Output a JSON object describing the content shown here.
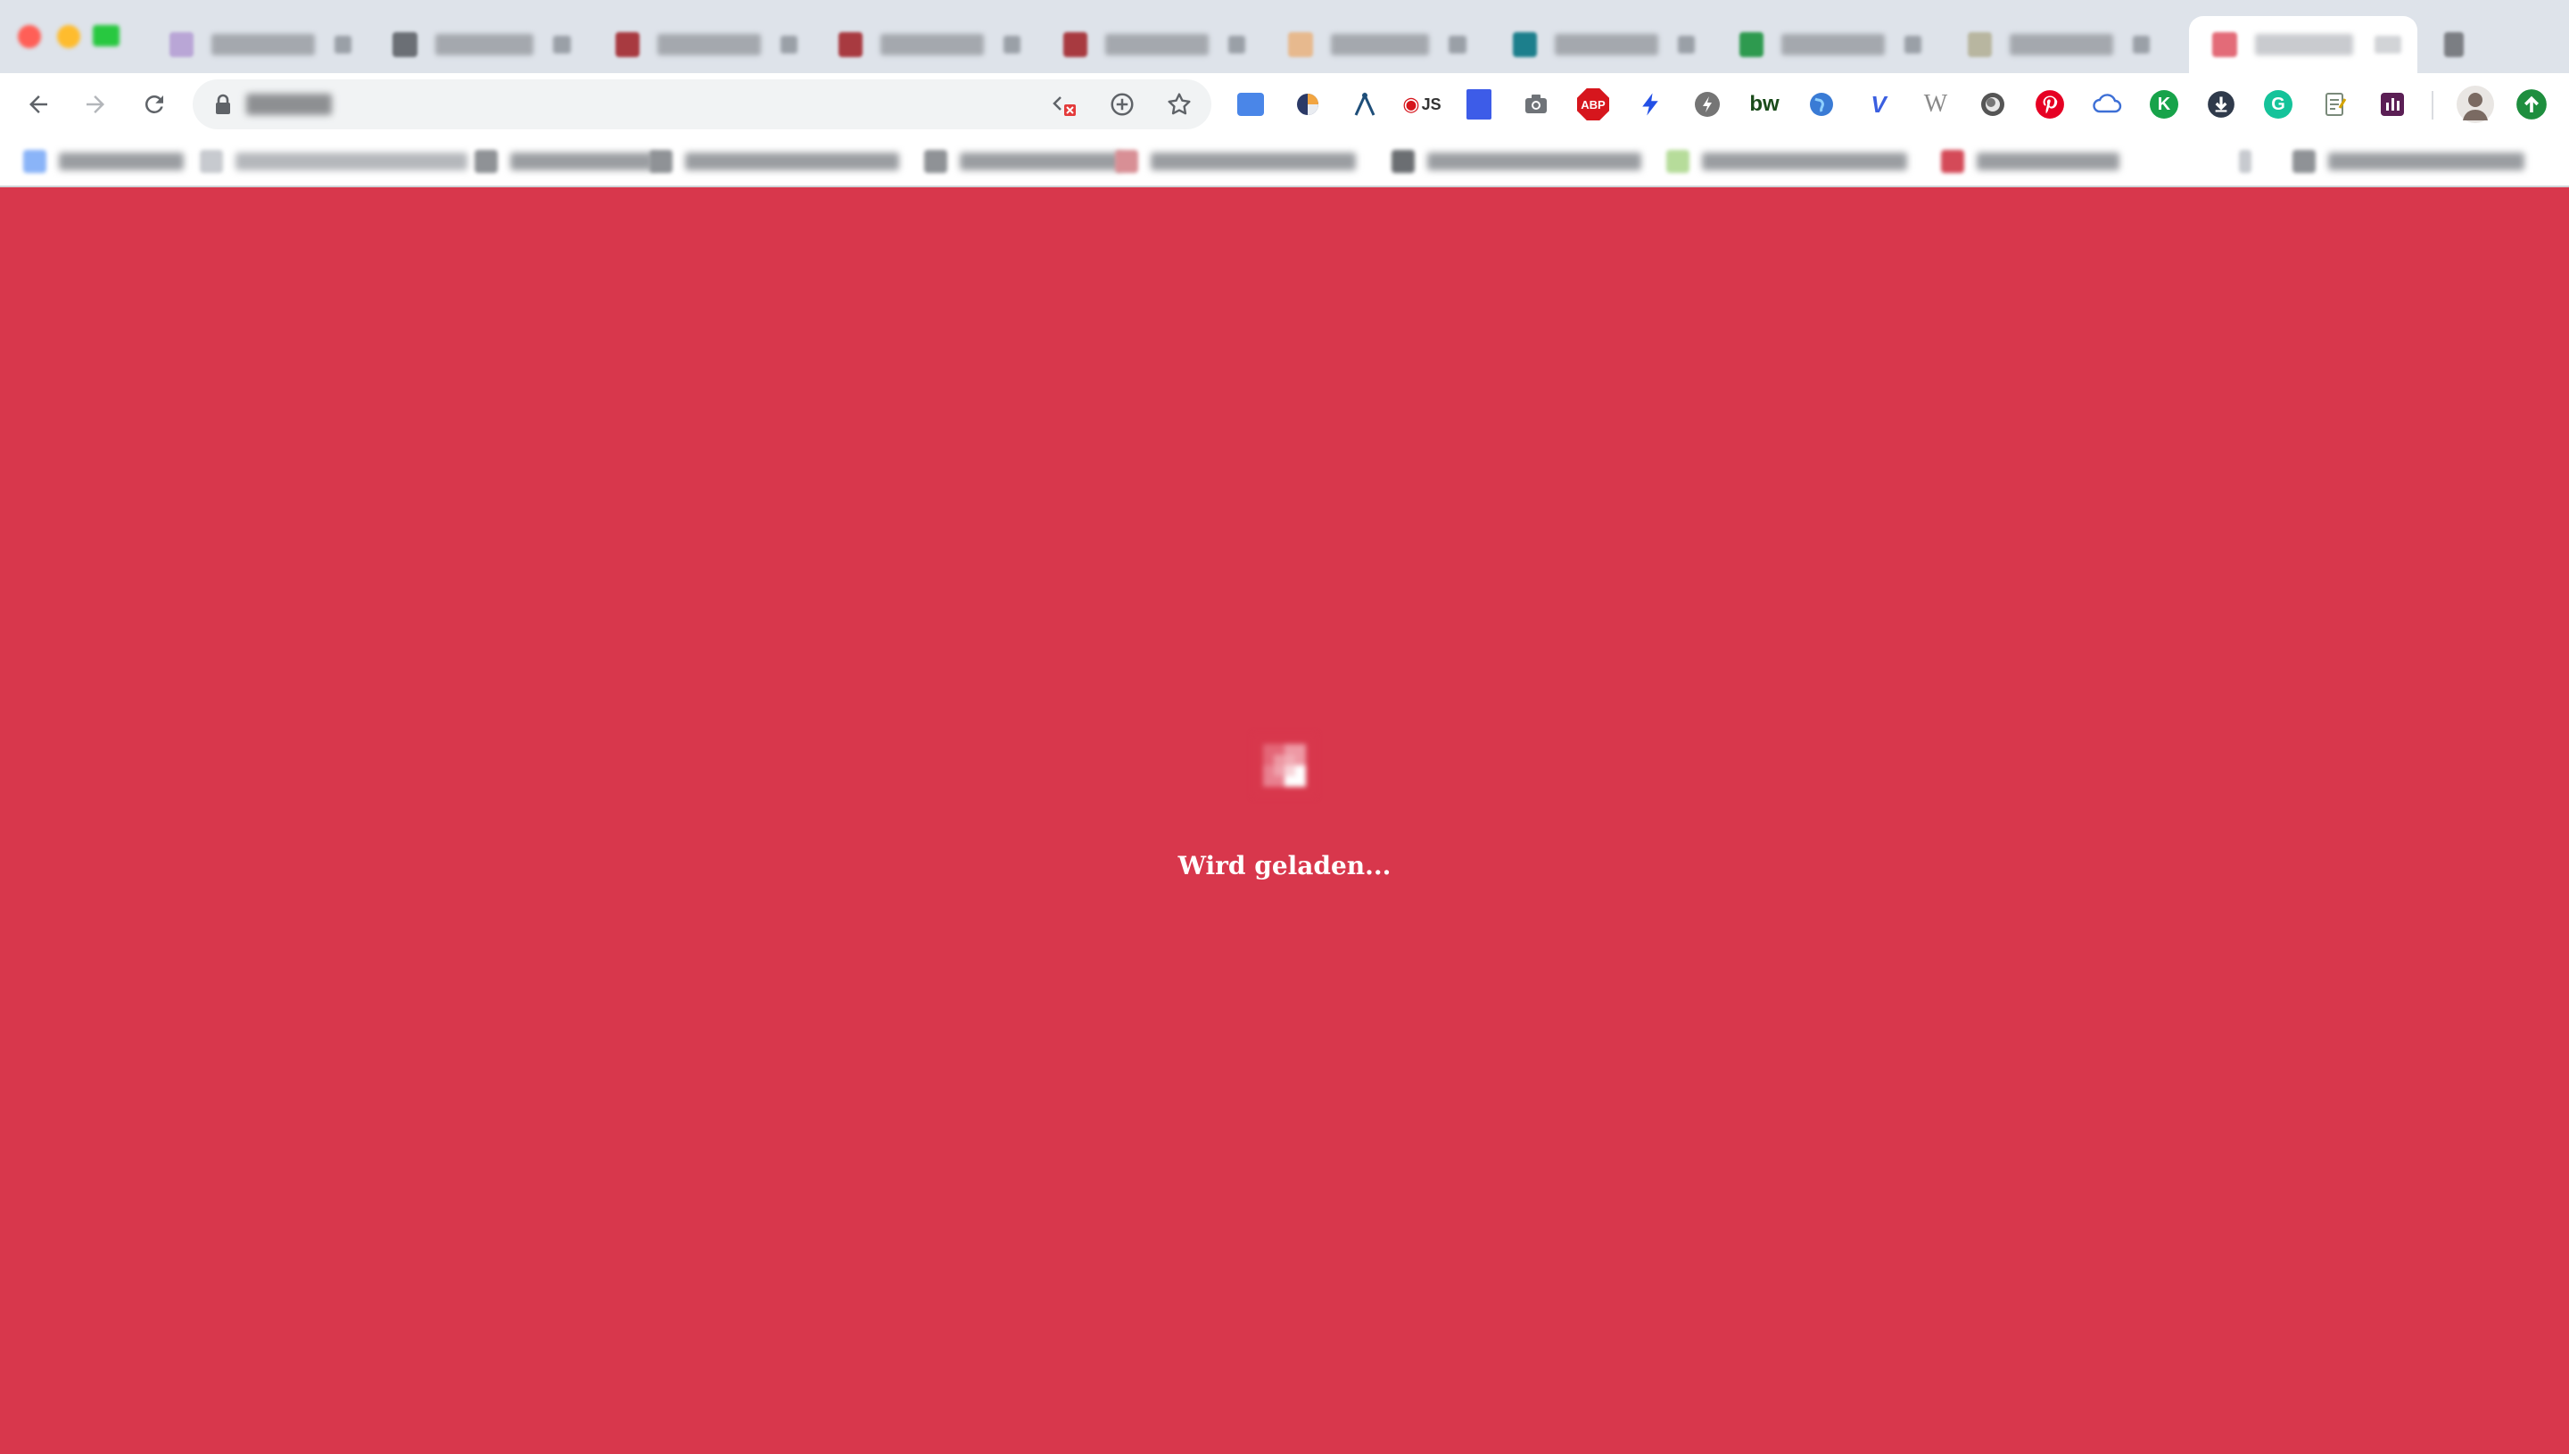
{
  "window": {
    "traffic_lights": [
      {
        "name": "close",
        "color": "#ff5f57"
      },
      {
        "name": "minimize",
        "color": "#febc2e"
      },
      {
        "name": "maximize",
        "color": "#28c840"
      }
    ]
  },
  "tabs": [
    {
      "title": "",
      "favicon_color": "#b9a6d6"
    },
    {
      "title": "",
      "favicon_color": "#6b6f75"
    },
    {
      "title": "",
      "favicon_color": "#a83a40"
    },
    {
      "title": "",
      "favicon_color": "#a83a40"
    },
    {
      "title": "",
      "favicon_color": "#a83a40"
    },
    {
      "title": "",
      "favicon_color": "#e7b98e"
    },
    {
      "title": "",
      "favicon_color": "#1c7f8c"
    },
    {
      "title": "",
      "favicon_color": "#2e9a4f"
    },
    {
      "title": "",
      "favicon_color": "#b8b6a0"
    },
    {
      "title": "",
      "favicon_color": "#e36b78",
      "active": true
    },
    {
      "title": "",
      "favicon_color": "#7b7e83"
    }
  ],
  "toolbar": {
    "url": "",
    "icons": [
      "back-icon",
      "forward-icon",
      "reload-icon",
      "lock-icon",
      "code-blocked-icon",
      "zoom-icon",
      "bookmark-star-icon"
    ]
  },
  "extensions": [
    {
      "name": "ext-translate",
      "label": "",
      "color": "#4a86e8"
    },
    {
      "name": "ext-colorpie",
      "label": "",
      "color": "#2b3a67"
    },
    {
      "name": "ext-vector",
      "label": "",
      "color": "#1e4e79"
    },
    {
      "name": "ext-js",
      "label": "JS",
      "color": "#555555"
    },
    {
      "name": "ext-ruler",
      "label": "",
      "color": "#3d5ce8"
    },
    {
      "name": "ext-camera",
      "label": "",
      "color": "#6f7378"
    },
    {
      "name": "ext-abp",
      "label": "ABP",
      "color": "#d6161d"
    },
    {
      "name": "ext-bolt",
      "label": "",
      "color": "#2350e6"
    },
    {
      "name": "ext-speed",
      "label": "",
      "color": "#757575"
    },
    {
      "name": "ext-bw",
      "label": "bw",
      "color": "#1a4b1a"
    },
    {
      "name": "ext-globe",
      "label": "",
      "color": "#3a7bd5"
    },
    {
      "name": "ext-v",
      "label": "V",
      "color": "#3b5fe0"
    },
    {
      "name": "ext-w",
      "label": "W",
      "color": "#8a8a8a"
    },
    {
      "name": "ext-circle",
      "label": "",
      "color": "#555555"
    },
    {
      "name": "ext-pinterest",
      "label": "",
      "color": "#e60023"
    },
    {
      "name": "ext-cloud",
      "label": "",
      "color": "#3d6fd6"
    },
    {
      "name": "ext-k",
      "label": "K",
      "color": "#17a34a"
    },
    {
      "name": "ext-download",
      "label": "",
      "color": "#2f3a4b"
    },
    {
      "name": "ext-grammarly",
      "label": "G",
      "color": "#15c39a"
    },
    {
      "name": "ext-note",
      "label": "",
      "color": "#7a8a7a"
    },
    {
      "name": "ext-chart",
      "label": "",
      "color": "#5b1f55"
    }
  ],
  "profile": {
    "avatar_color": "#7a6a62",
    "update_color": "#1e8e3e"
  },
  "bookmarks": [
    {
      "label": "",
      "favicon_color": "#8ab4f8"
    },
    {
      "label": "",
      "favicon_color": "#c7cacf"
    },
    {
      "label": "",
      "favicon_color": "#8f9296"
    },
    {
      "label": "",
      "favicon_color": "#8f9296"
    },
    {
      "label": "",
      "favicon_color": "#8f9296"
    },
    {
      "label": "",
      "favicon_color": "#d88f95"
    },
    {
      "label": "",
      "favicon_color": "#6b6e72"
    },
    {
      "label": "",
      "favicon_color": "#b6dc9a"
    },
    {
      "label": "",
      "favicon_color": "#d44a58"
    },
    {
      "label": "",
      "favicon_color": "#c7cacf"
    },
    {
      "label": "",
      "favicon_color": "#8f9296"
    }
  ],
  "content": {
    "background": "#d8374c",
    "loading_text": "Wird geladen..."
  }
}
